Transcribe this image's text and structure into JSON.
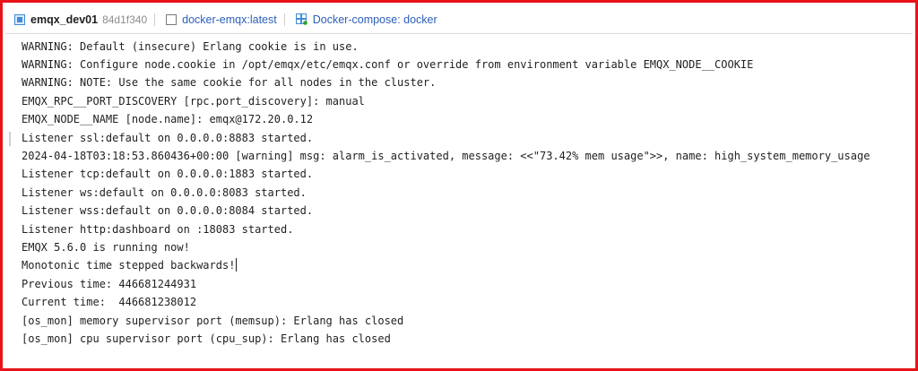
{
  "tabs": [
    {
      "title": "emqx_dev01",
      "hash": "84d1f340",
      "icon": "container-icon",
      "icon_color": "#3f8bd6"
    },
    {
      "title": "docker-emqx:latest",
      "icon": "image-icon"
    },
    {
      "title": "Docker-compose: docker",
      "icon": "compose-icon",
      "badge_color": "#2ca02c"
    }
  ],
  "console": {
    "lines": [
      "WARNING: Default (insecure) Erlang cookie is in use.",
      "WARNING: Configure node.cookie in /opt/emqx/etc/emqx.conf or override from environment variable EMQX_NODE__COOKIE",
      "WARNING: NOTE: Use the same cookie for all nodes in the cluster.",
      "EMQX_RPC__PORT_DISCOVERY [rpc.port_discovery]: manual",
      "EMQX_NODE__NAME [node.name]: emqx@172.20.0.12",
      "Listener ssl:default on 0.0.0.0:8883 started.",
      "2024-04-18T03:18:53.860436+00:00 [warning] msg: alarm_is_activated, message: <<\"73.42% mem usage\">>, name: high_system_memory_usage",
      "Listener tcp:default on 0.0.0.0:1883 started.",
      "Listener ws:default on 0.0.0.0:8083 started.",
      "Listener wss:default on 0.0.0.0:8084 started.",
      "Listener http:dashboard on :18083 started.",
      "EMQX 5.6.0 is running now!",
      "Monotonic time stepped backwards!",
      "Previous time: 446681244931",
      "Current time:  446681238012",
      "[os_mon] memory supervisor port (memsup): Erlang has closed",
      "[os_mon] cpu supervisor port (cpu_sup): Erlang has closed"
    ]
  },
  "colors": {
    "frame_border": "#e8141a",
    "tab_link": "#2b5fb8"
  }
}
